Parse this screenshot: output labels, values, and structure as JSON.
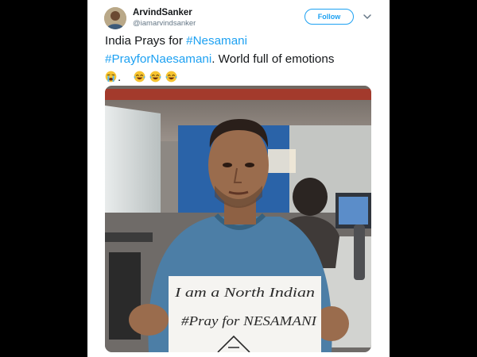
{
  "tweet": {
    "author_name": "ArvindSanker",
    "author_handle": "@iamarvindsanker",
    "follow_label": "Follow",
    "text_line1_plain": "India Prays for ",
    "text_line1_hashtag": "#Nesamani",
    "text_line2_hashtag": "#PrayforNaesamani",
    "text_line2_plain": ". World full of emotions",
    "text_line3_period": ".",
    "emojis": [
      "loudly-crying-face-icon",
      "face-with-tears-of-joy-icon",
      "face-with-tears-of-joy-icon",
      "face-with-tears-of-joy-icon"
    ]
  },
  "photo": {
    "sign_line1": "I am a North Indian",
    "sign_line2": "#Pray for NESAMANI"
  },
  "colors": {
    "link": "#1da1f2",
    "text": "#14171a",
    "muted": "#657786",
    "background": "#000000"
  }
}
